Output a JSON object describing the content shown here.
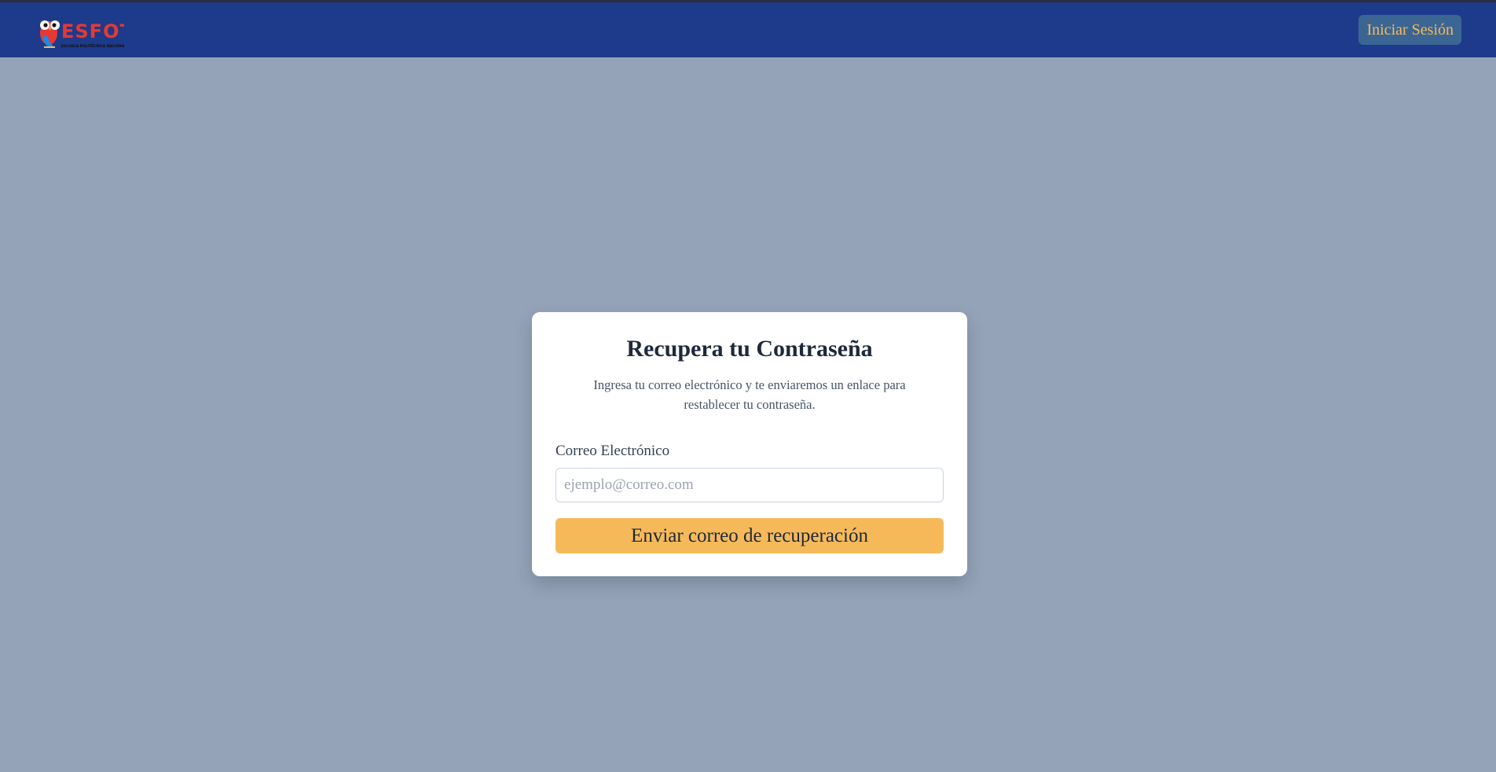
{
  "brand": {
    "name": "ESFOT",
    "tagline": "ESCUELA POLITÉCNICA NACIONAL",
    "logo_icon": "owl-icon",
    "colors": {
      "navbar": "#1e3a8a",
      "accent": "#f6b95a",
      "logo_red": "#e53935"
    }
  },
  "navbar": {
    "login_label": "Iniciar Sesión"
  },
  "recovery": {
    "title": "Recupera tu Contraseña",
    "description": "Ingresa tu correo electrónico y te enviaremos un enlace para restablecer tu contraseña.",
    "email_label": "Correo Electrónico",
    "email_placeholder": "ejemplo@correo.com",
    "email_value": "",
    "submit_label": "Enviar correo de recuperación"
  }
}
